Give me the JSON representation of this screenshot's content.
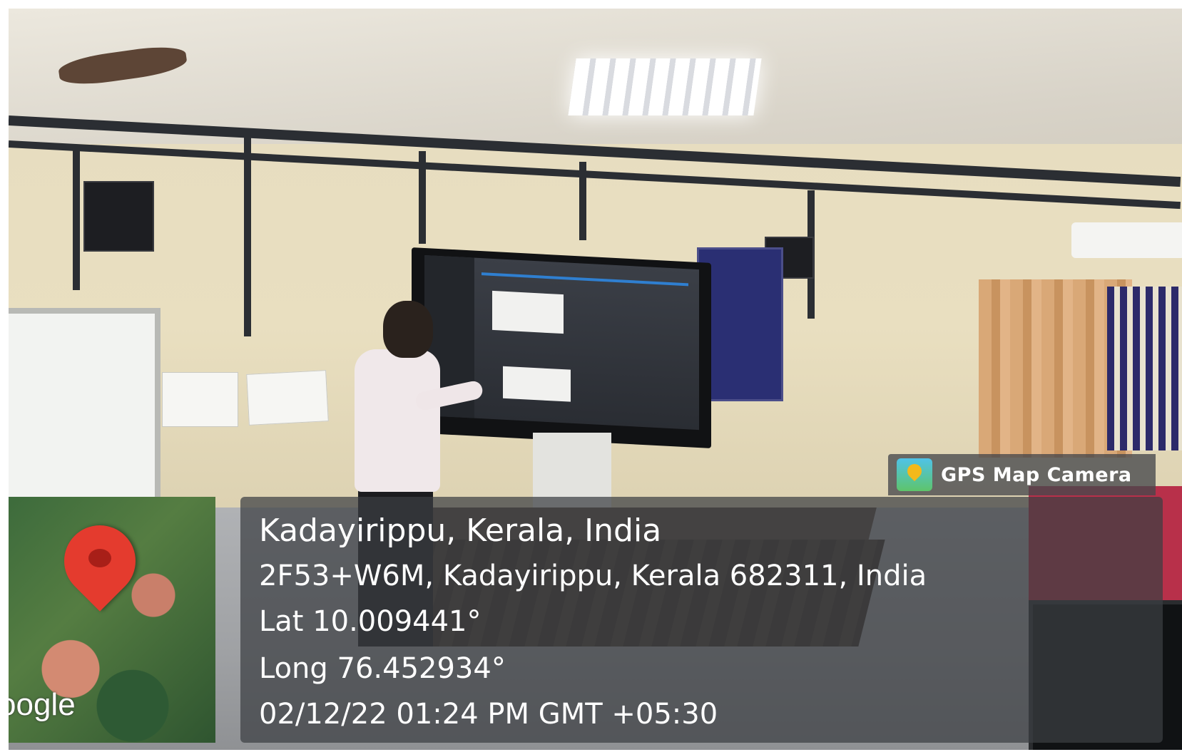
{
  "overlay": {
    "badge_label": "GPS Map Camera",
    "place": "Kadayirippu, Kerala, India",
    "address": "2F53+W6M, Kadayirippu, Kerala 682311, India",
    "latitude": "Lat 10.009441°",
    "longitude": "Long 76.452934°",
    "timestamp": "02/12/22 01:24 PM GMT +05:30"
  },
  "map": {
    "logo_text": "oogle"
  },
  "colors": {
    "pin": "#e43b2e",
    "panel": "#3c3e42",
    "text": "#ffffff"
  }
}
